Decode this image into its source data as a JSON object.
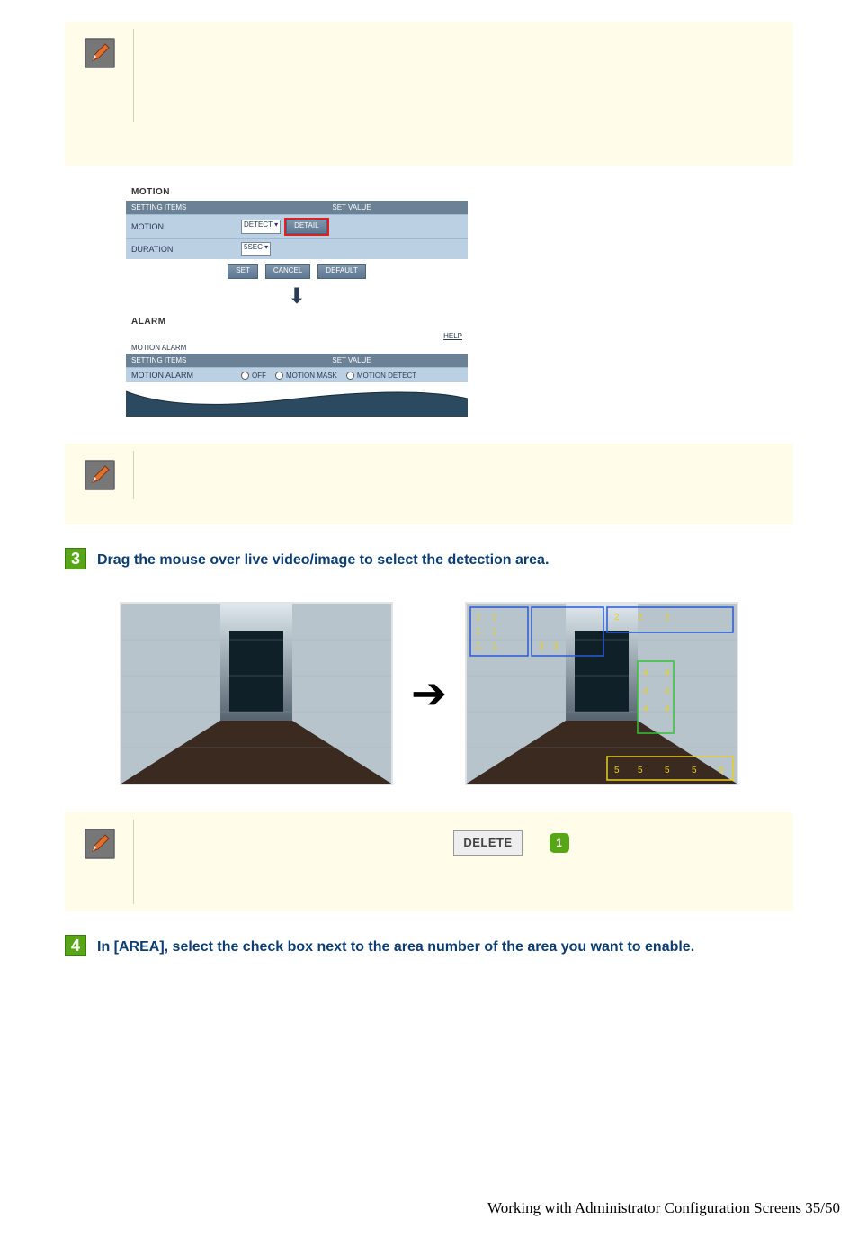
{
  "motion_panel": {
    "title": "MOTION",
    "header_col1": "SETTING ITEMS",
    "header_col2": "SET VALUE",
    "row_motion_label": "MOTION",
    "row_motion_select": "DETECT",
    "row_motion_detail_btn": "DETAIL",
    "row_duration_label": "DURATION",
    "row_duration_select": "5SEC",
    "btn_set": "SET",
    "btn_cancel": "CANCEL",
    "btn_default": "DEFAULT"
  },
  "alarm_panel": {
    "title": "ALARM",
    "help": "HELP",
    "subhead": "MOTION ALARM",
    "header_col1": "SETTING ITEMS",
    "header_col2": "SET VALUE",
    "row_label": "MOTION ALARM",
    "opt_off": "OFF",
    "opt_mask": "MOTION MASK",
    "opt_detect": "MOTION DETECT"
  },
  "step3": {
    "num": "3",
    "text": "Drag the mouse over live video/image to select the detection area."
  },
  "note3": {
    "delete_btn": "DELETE",
    "badge": "1"
  },
  "step4": {
    "num": "4",
    "text": "In [AREA], select the check box next to the area number of the area you want to enable."
  },
  "footer": "Working with Administrator Configuration Screens 35/50"
}
